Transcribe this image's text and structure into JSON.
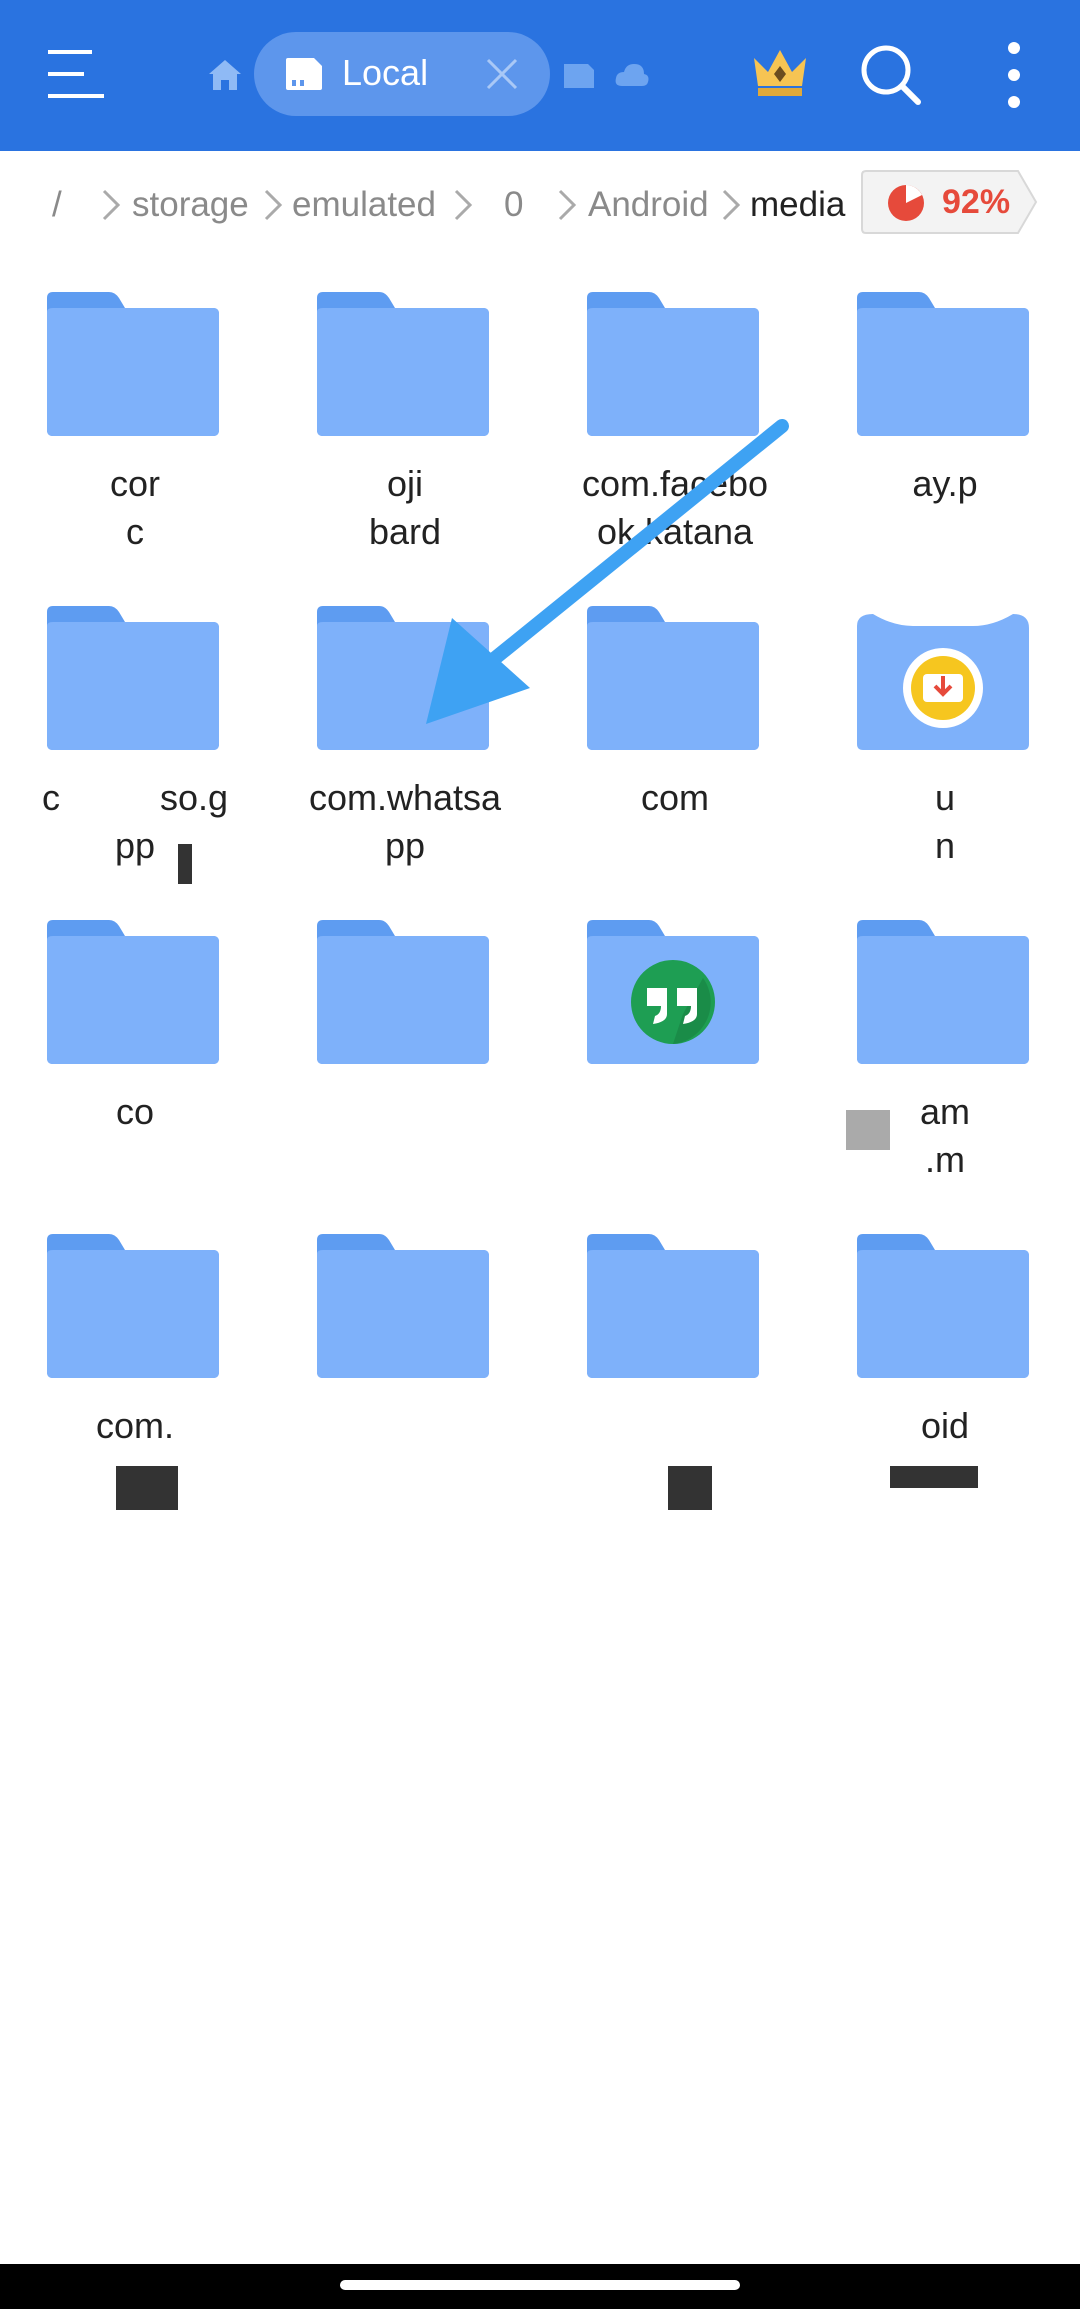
{
  "topbar": {
    "bg_color": "#2a73e0",
    "menu_icon": "hamburger-menu-icon",
    "home_icon": "home-icon",
    "local_tab_label": "Local",
    "local_tab_icon": "phone-storage-icon",
    "close_icon": "close-icon",
    "sdcard_icon": "sd-card-icon",
    "cloud_icon": "cloud-icon",
    "premium_icon": "crown-icon",
    "search_icon": "search-icon",
    "more_icon": "more-vertical-icon"
  },
  "breadcrumb": {
    "items": [
      "/",
      "storage",
      "emulated",
      "0",
      "Android",
      "media"
    ],
    "storage_percent": "92%",
    "storage_icon": "pie-chart-icon",
    "accent_color": "#e64a3b"
  },
  "folders": [
    {
      "label": "cor\nc"
    },
    {
      "label": "oji\nbard"
    },
    {
      "label": "com.facebo\nok.katana"
    },
    {
      "label": "ay.p"
    },
    {
      "label": "c          so.g\npp"
    },
    {
      "label": "com.whatsa\npp"
    },
    {
      "label": "com"
    },
    {
      "label": "u\nn",
      "icon": "download-folder-icon"
    },
    {
      "label": "co"
    },
    {
      "label": ""
    },
    {
      "label": "",
      "icon": "hangouts-quote-icon"
    },
    {
      "label": "am\n.m"
    },
    {
      "label": "com.\nsa"
    },
    {
      "label": ""
    },
    {
      "label": ""
    },
    {
      "label": "oid"
    }
  ],
  "colors": {
    "folder": "#7eb1fa",
    "folder_tab": "#5e9cf1",
    "annotation_arrow": "#3ea2f3"
  }
}
